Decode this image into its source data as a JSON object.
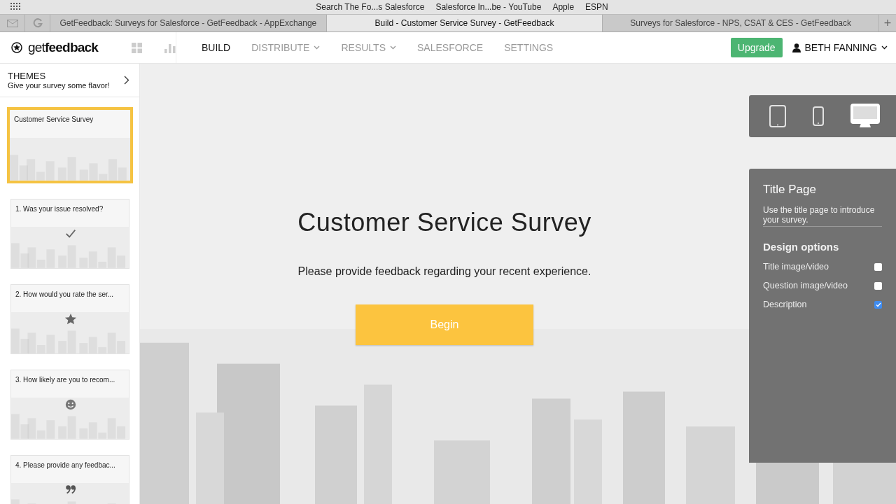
{
  "bookmarks": [
    "Search The Fo...s Salesforce",
    "Salesforce In...be - YouTube",
    "Apple",
    "ESPN"
  ],
  "browser_tabs": [
    {
      "label": "GetFeedback: Surveys for Salesforce - GetFeedback - AppExchange",
      "selected": false
    },
    {
      "label": "Build - Customer Service Survey - GetFeedback",
      "selected": true
    },
    {
      "label": "Surveys for Salesforce - NPS, CSAT & CES - GetFeedback",
      "selected": false
    }
  ],
  "new_tab": "+",
  "logo": "get**feedback**",
  "nav": [
    {
      "label": "BUILD",
      "selected": true,
      "dropdown": false
    },
    {
      "label": "DISTRIBUTE",
      "selected": false,
      "dropdown": true
    },
    {
      "label": "RESULTS",
      "selected": false,
      "dropdown": true
    },
    {
      "label": "SALESFORCE",
      "selected": false,
      "dropdown": false
    },
    {
      "label": "SETTINGS",
      "selected": false,
      "dropdown": false
    }
  ],
  "upgrade_button": "Upgrade",
  "user": "BETH FANNING",
  "themes": {
    "title": "THEMES",
    "subtitle": "Give your survey some flavor!"
  },
  "slides": [
    {
      "title": "Customer Service Survey",
      "kind": "title",
      "selected": true
    },
    {
      "title": "1. Was your issue resolved?",
      "kind": "check",
      "selected": false
    },
    {
      "title": "2. How would you rate the ser...",
      "kind": "star",
      "selected": false
    },
    {
      "title": "3. How likely are you to recom...",
      "kind": "smiley",
      "selected": false
    },
    {
      "title": "4. Please provide any feedbac...",
      "kind": "quote",
      "selected": false
    }
  ],
  "survey": {
    "title": "Customer Service Survey",
    "description": "Please provide feedback regarding your recent experience.",
    "button": "Begin"
  },
  "devices": [
    {
      "kind": "tablet",
      "selected": false
    },
    {
      "kind": "phone",
      "selected": false
    },
    {
      "kind": "desktop",
      "selected": true
    }
  ],
  "panel": {
    "title": "Title Page",
    "hint": "Use the title page to introduce your survey.",
    "section": "Design options",
    "options": [
      {
        "label": "Title image/video",
        "checked": false
      },
      {
        "label": "Question image/video",
        "checked": false
      },
      {
        "label": "Description",
        "checked": true
      }
    ]
  }
}
